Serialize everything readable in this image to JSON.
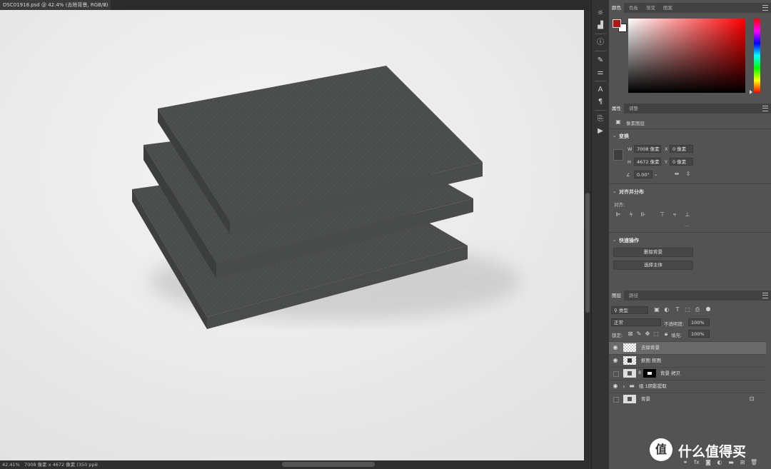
{
  "document": {
    "tab_title": "DSC01918.psd @ 42.4% (去除背景, RGB/8)",
    "close_glyph": "×",
    "status_zoom": "42.41%",
    "status_info": "7008 像素 x 4672 像素 (350 ppi)",
    "status_arrow": "›"
  },
  "color_panel": {
    "tabs": [
      "颜色",
      "色板",
      "渐变",
      "图案"
    ],
    "fg_color": "#b01818",
    "bg_color": "#ffffff",
    "hue_color": "#ff0000"
  },
  "properties_panel": {
    "tabs": [
      "属性",
      "调整"
    ],
    "layer_type": "像素图层",
    "transform": {
      "header": "变换",
      "w_label": "W",
      "w_value": "7008 像素",
      "x_label": "X",
      "x_value": "0 像素",
      "h_label": "H",
      "h_value": "4672 像素",
      "y_label": "Y",
      "y_value": "0 像素",
      "angle_value": "0.00°"
    },
    "align": {
      "header": "对齐并分布",
      "sub_label": "对齐:",
      "more": "..."
    },
    "quick_actions": {
      "header": "快速操作",
      "remove_bg": "删除背景",
      "select_subject": "选择主体"
    }
  },
  "layers_panel": {
    "tabs": [
      "图层",
      "路径"
    ],
    "filter_kind": "类型",
    "blend_mode": "正常",
    "opacity_label": "不透明度:",
    "opacity_value": "100%",
    "lock_label": "锁定:",
    "fill_label": "填充:",
    "fill_value": "100%",
    "layers": [
      {
        "name": "去除背景",
        "visible": true,
        "selected": true
      },
      {
        "name": "抠图 抠图",
        "visible": true,
        "selected": false
      },
      {
        "name": "背景 拷贝",
        "visible": false,
        "selected": false
      },
      {
        "name": "组 1阴影提取",
        "visible": true,
        "selected": false
      },
      {
        "name": "背景",
        "visible": false,
        "selected": false
      }
    ]
  },
  "watermark": {
    "icon_text": "值",
    "text": "什么值得买"
  }
}
